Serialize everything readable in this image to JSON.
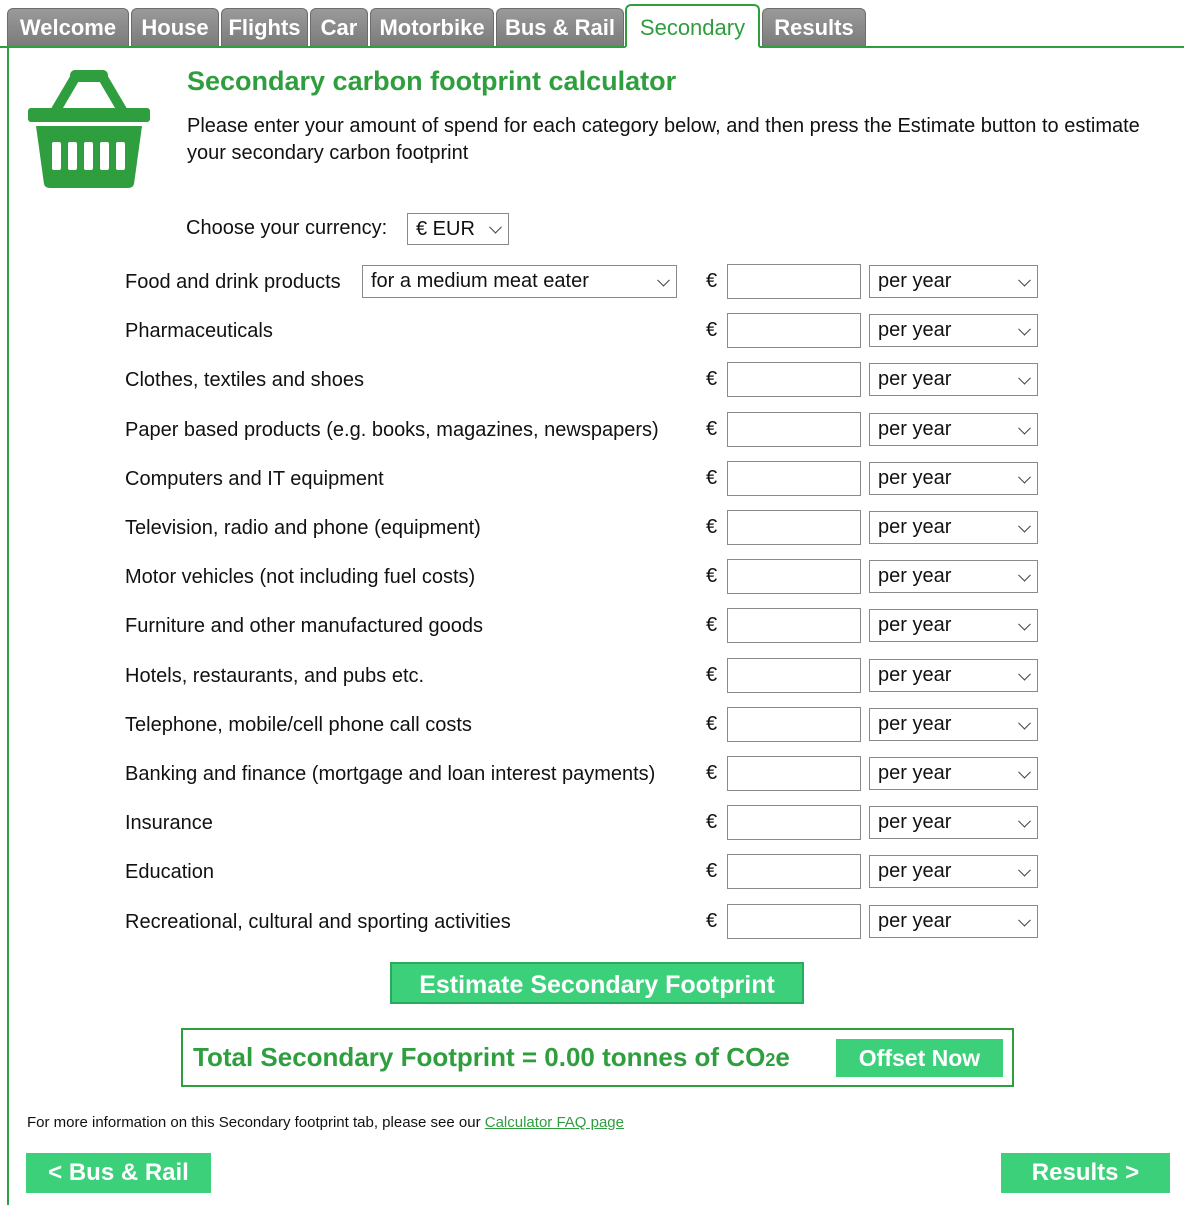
{
  "tabs": [
    {
      "label": "Welcome",
      "active": false
    },
    {
      "label": "House",
      "active": false
    },
    {
      "label": "Flights",
      "active": false
    },
    {
      "label": "Car",
      "active": false
    },
    {
      "label": "Motorbike",
      "active": false
    },
    {
      "label": "Bus & Rail",
      "active": false
    },
    {
      "label": "Secondary",
      "active": true
    },
    {
      "label": "Results",
      "active": false
    }
  ],
  "icon": "shopping-basket-icon",
  "title": "Secondary carbon footprint calculator",
  "intro": "Please enter your amount of spend for each category below, and then press the Estimate button to estimate your secondary carbon footprint",
  "currency": {
    "label": "Choose your currency:",
    "value": "€ EUR"
  },
  "currency_symbol": "€",
  "food_diet_option": "for a medium meat eater",
  "rows": [
    {
      "label": "Food and drink products",
      "amount": "",
      "period": "per year"
    },
    {
      "label": "Pharmaceuticals",
      "amount": "",
      "period": "per year"
    },
    {
      "label": "Clothes, textiles and shoes",
      "amount": "",
      "period": "per year"
    },
    {
      "label": "Paper based products (e.g. books, magazines, newspapers)",
      "amount": "",
      "period": "per year"
    },
    {
      "label": "Computers and IT equipment",
      "amount": "",
      "period": "per year"
    },
    {
      "label": "Television, radio and phone (equipment)",
      "amount": "",
      "period": "per year"
    },
    {
      "label": "Motor vehicles (not including fuel costs)",
      "amount": "",
      "period": "per year"
    },
    {
      "label": "Furniture and other manufactured goods",
      "amount": "",
      "period": "per year"
    },
    {
      "label": "Hotels, restaurants, and pubs etc.",
      "amount": "",
      "period": "per year"
    },
    {
      "label": "Telephone, mobile/cell phone call costs",
      "amount": "",
      "period": "per year"
    },
    {
      "label": "Banking and finance (mortgage and loan interest payments)",
      "amount": "",
      "period": "per year"
    },
    {
      "label": "Insurance",
      "amount": "",
      "period": "per year"
    },
    {
      "label": "Education",
      "amount": "",
      "period": "per year"
    },
    {
      "label": "Recreational, cultural and sporting activities",
      "amount": "",
      "period": "per year"
    }
  ],
  "estimate_button": "Estimate Secondary Footprint",
  "total": {
    "prefix": "Total Secondary Footprint = 0.00 tonnes of CO",
    "subscript": "2",
    "suffix": "e"
  },
  "offset_button": "Offset Now",
  "faq": {
    "text": "For more information on this Secondary footprint tab, please see our ",
    "link": "Calculator FAQ page"
  },
  "prev_button": "< Bus & Rail",
  "next_button": "Results >",
  "colors": {
    "brand_green": "#2e9e3e",
    "button_green": "#3dd07b",
    "tab_grey": "#8a8a8a"
  }
}
